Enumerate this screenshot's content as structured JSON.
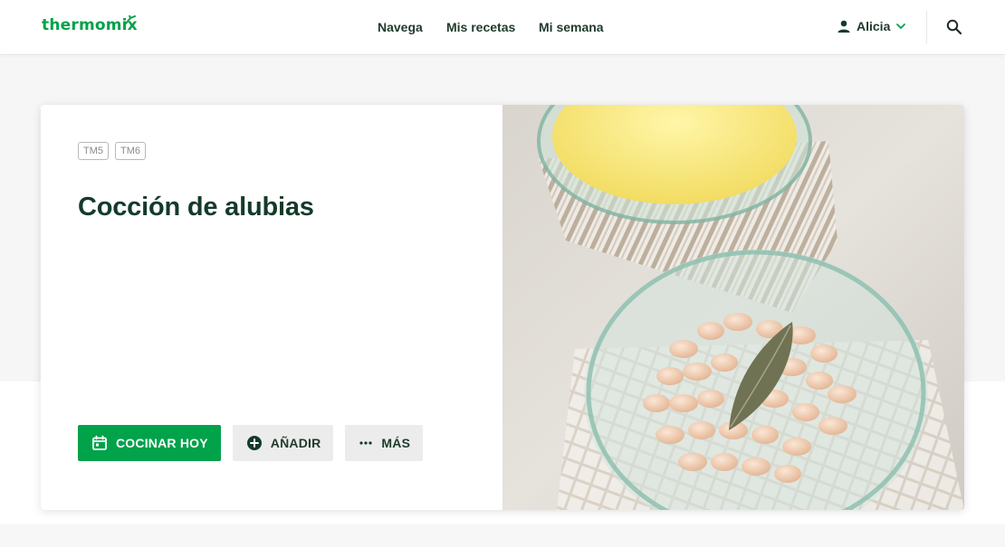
{
  "header": {
    "logo": "thermomix",
    "nav": [
      {
        "label": "Navega"
      },
      {
        "label": "Mis recetas"
      },
      {
        "label": "Mi semana"
      }
    ],
    "user_name": "Alicia",
    "user_icon": "person-icon",
    "dropdown_icon": "chevron-down-icon",
    "search_icon": "search-icon"
  },
  "recipe": {
    "tags": [
      "TM5",
      "TM6"
    ],
    "title": "Cocción de alubias",
    "actions": {
      "cook_today": "COCINAR HOY",
      "add": "AÑADIR",
      "more": "MÁS"
    },
    "image_alt": "Recipe photo: glass bowl of cooked white beans with a bay leaf, and a bowl of broth on a striped napkin"
  },
  "colors": {
    "brand_green": "#00a24a",
    "title_green": "#143a2a",
    "secondary_button": "#ececec"
  }
}
